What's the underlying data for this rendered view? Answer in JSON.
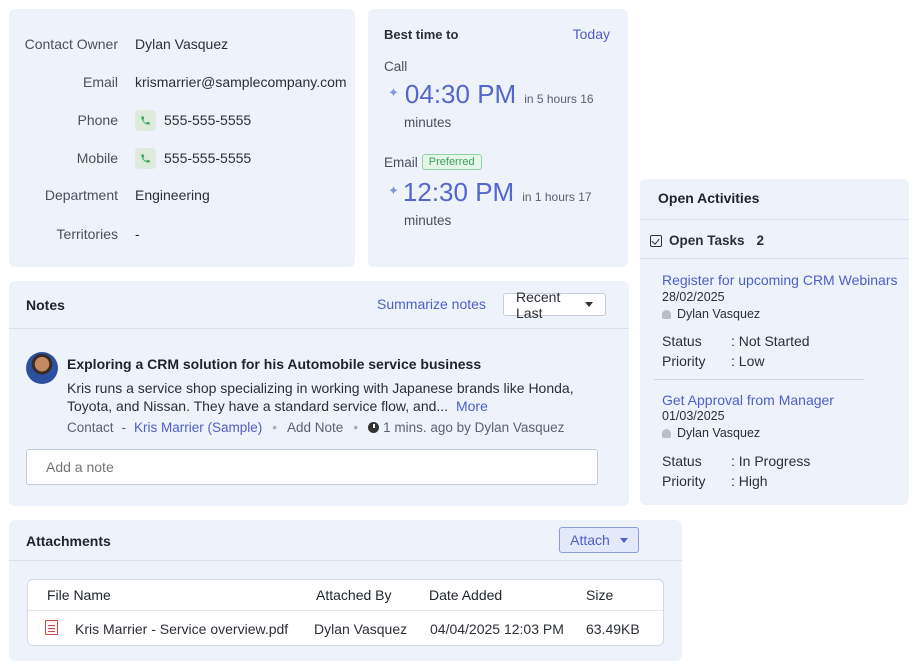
{
  "contact": {
    "fields": [
      {
        "label": "Contact Owner",
        "value": "Dylan Vasquez"
      },
      {
        "label": "Email",
        "value": "krismarrier@samplecompany.com"
      },
      {
        "label": "Phone",
        "value": "555-555-5555"
      },
      {
        "label": "Mobile",
        "value": "555-555-5555"
      },
      {
        "label": "Department",
        "value": "Engineering"
      },
      {
        "label": "Territories",
        "value": "-"
      }
    ]
  },
  "best_time": {
    "title": "Best time to",
    "today_link": "Today",
    "call": {
      "label": "Call",
      "time": "04:30 PM",
      "in": "in 5 hours 16",
      "unit": "minutes"
    },
    "email": {
      "label": "Email",
      "badge": "Preferred",
      "time": "12:30 PM",
      "in": "in 1 hours 17",
      "unit": "minutes"
    }
  },
  "notes": {
    "title": "Notes",
    "summarize": "Summarize notes",
    "sort_label": "Recent Last",
    "note": {
      "title": "Exploring a CRM solution for his Automobile service business",
      "body": "Kris runs a service shop specializing in working with Japanese brands like Honda, Toyota, and Nissan. They have a standard service flow, and...",
      "more": "More",
      "meta_type": "Contact",
      "meta_sep": "-",
      "meta_contact": "Kris Marrier (Sample)",
      "add_note": "Add Note",
      "meta_time": "1 mins. ago by Dylan Vasquez"
    },
    "add_placeholder": "Add a note"
  },
  "activities": {
    "title": "Open Activities",
    "tasks_label": "Open Tasks",
    "tasks_count": "2",
    "tasks": [
      {
        "title": "Register for upcoming CRM Webinars",
        "date": "28/02/2025",
        "owner": "Dylan Vasquez",
        "status_key": "Status",
        "status": ": Not Started",
        "priority_key": "Priority",
        "priority": ": Low"
      },
      {
        "title": "Get Approval from Manager",
        "date": "01/03/2025",
        "owner": "Dylan Vasquez",
        "status_key": "Status",
        "status": ": In Progress",
        "priority_key": "Priority",
        "priority": ": High"
      }
    ]
  },
  "attachments": {
    "title": "Attachments",
    "attach_label": "Attach",
    "columns": [
      "File Name",
      "Attached By",
      "Date Added",
      "Size"
    ],
    "rows": [
      {
        "file": "Kris Marrier - Service overview.pdf",
        "by": "Dylan Vasquez",
        "date": "04/04/2025 12:03 PM",
        "size": "63.49KB"
      }
    ]
  }
}
